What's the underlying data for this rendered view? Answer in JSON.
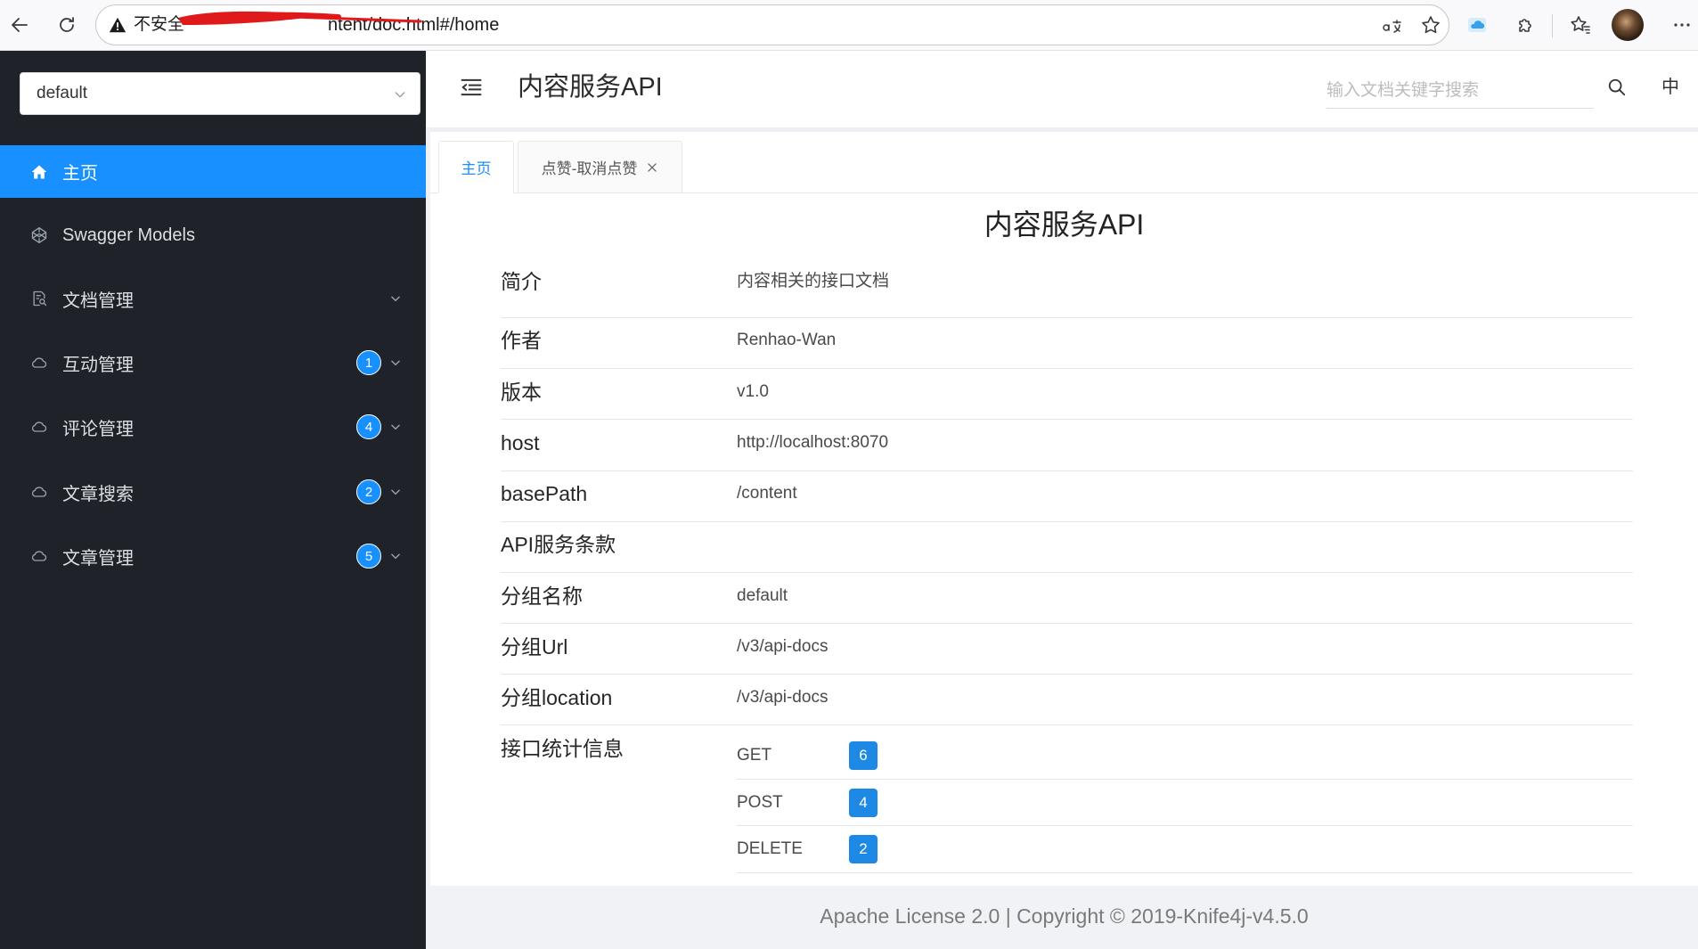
{
  "browser": {
    "insecure_label": "不安全",
    "url_visible": "ntent/doc.html#/home"
  },
  "sidebar": {
    "group_select": {
      "value": "default"
    },
    "items": [
      {
        "label": "主页",
        "icon": "home-icon",
        "active": true
      },
      {
        "label": "Swagger Models",
        "icon": "codepen-icon"
      },
      {
        "label": "文档管理",
        "icon": "file-search-icon"
      },
      {
        "label": "互动管理",
        "icon": "cloud-icon",
        "count": 1
      },
      {
        "label": "评论管理",
        "icon": "cloud-icon",
        "count": 4
      },
      {
        "label": "文章搜索",
        "icon": "cloud-icon",
        "count": 2
      },
      {
        "label": "文章管理",
        "icon": "cloud-icon",
        "count": 5
      }
    ]
  },
  "header": {
    "title": "内容服务API",
    "search_placeholder": "输入文档关键字搜索",
    "language": "中"
  },
  "tabs": [
    {
      "label": "主页",
      "active": true
    },
    {
      "label": "点赞-取消点赞",
      "closable": true
    }
  ],
  "doc": {
    "title": "内容服务API",
    "rows": [
      {
        "label": "简介",
        "value": "内容相关的接口文档"
      },
      {
        "label": "作者",
        "value": "Renhao-Wan"
      },
      {
        "label": "版本",
        "value": "v1.0"
      },
      {
        "label": "host",
        "value": "http://localhost:8070"
      },
      {
        "label": "basePath",
        "value": "/content"
      },
      {
        "label": "API服务条款"
      },
      {
        "label": "分组名称",
        "value": "default"
      },
      {
        "label": "分组Url",
        "value": "/v3/api-docs"
      },
      {
        "label": "分组location",
        "value": "/v3/api-docs"
      }
    ],
    "stats": {
      "label": "接口统计信息",
      "methods": [
        {
          "method": "GET",
          "count": 6
        },
        {
          "method": "POST",
          "count": 4
        },
        {
          "method": "DELETE",
          "count": 2
        }
      ]
    }
  },
  "footer": {
    "text": "Apache License 2.0 | Copyright © 2019-Knife4j-v4.5.0"
  },
  "colors": {
    "accent": "#1890ff",
    "sidebar_bg": "#1f2229",
    "method_badge": "#1e88e5",
    "footer_bg": "#f0f2f5"
  }
}
